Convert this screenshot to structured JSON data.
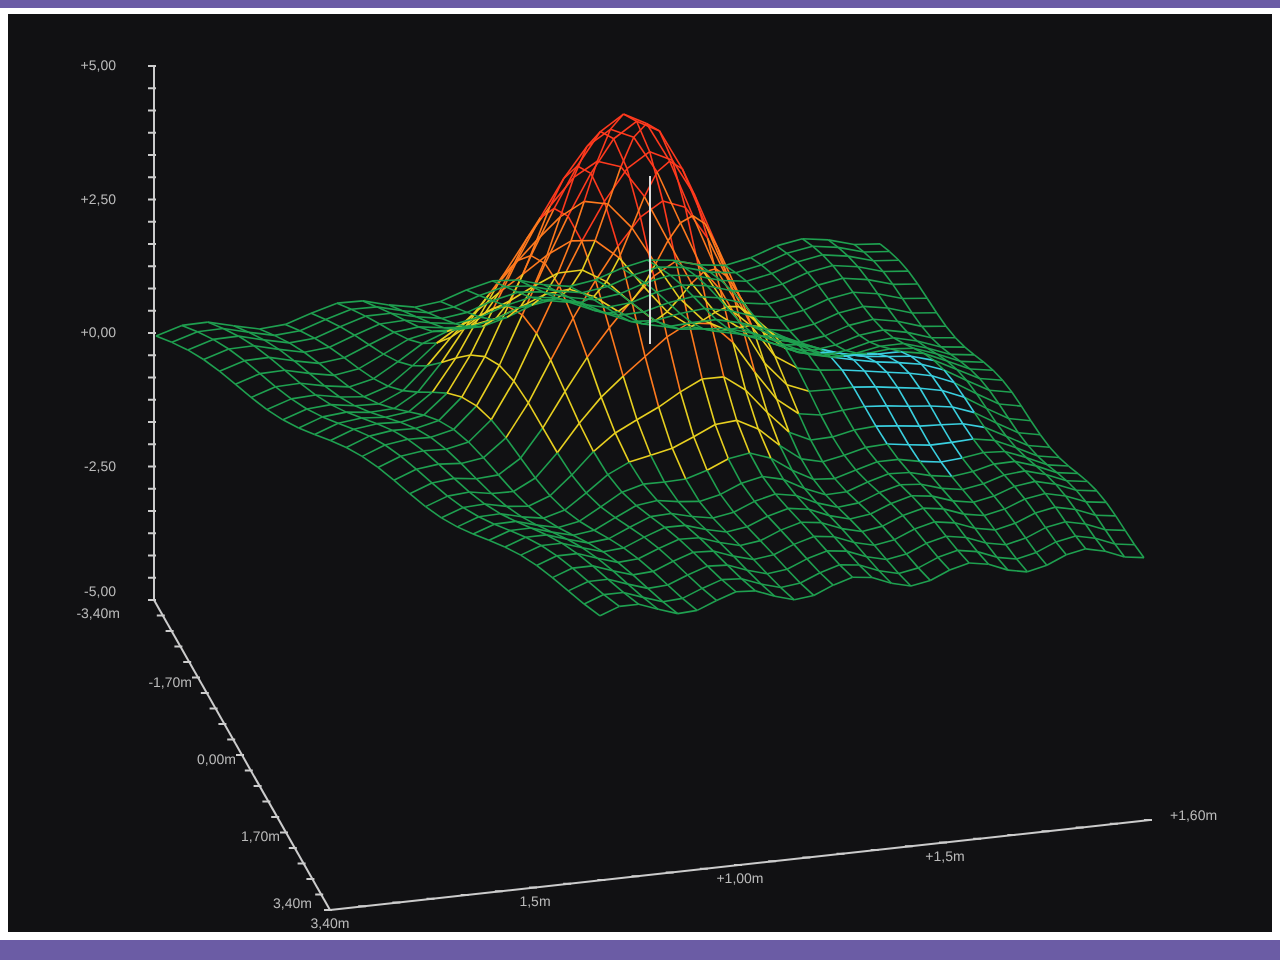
{
  "plot": {
    "z_axis_labels": [
      "+5,00",
      "+2,50",
      "+0,00",
      "-2,50",
      "-5,00"
    ],
    "depth_axis_labels": [
      "-3,40m",
      "-1,70m",
      "0,00m",
      "1,70m",
      "3,40m"
    ],
    "x_axis_labels": [
      "3,40m",
      "1,5m",
      "+1,00m",
      "+1,5m",
      "+1,60m"
    ]
  }
}
